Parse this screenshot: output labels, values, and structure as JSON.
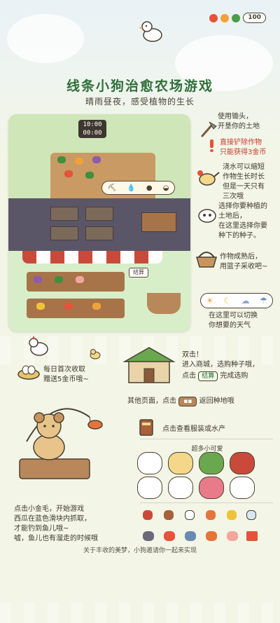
{
  "status": {
    "coins": "100",
    "colors": [
      "#e5533a",
      "#f0a23a",
      "#4a9c4c"
    ]
  },
  "header": {
    "title": "线条小狗治愈农场游戏",
    "subtitle": "晴雨昼夜，感受植物的生长"
  },
  "game_preview": {
    "clock_top": "10:00",
    "clock_bottom": "00:00",
    "checkout_label": "结算"
  },
  "instructions": {
    "hoe": "使用锄头，\n开垦你的土地",
    "shovel": "直接铲除作物\n只能获得3金币",
    "water": "浇水可以缩短\n作物生长时长\n但是一天只有\n三次哦",
    "seed": "选择你要种植的\n土地后，\n在这里选择你要\n种下的种子。",
    "harvest": "作物成熟后，\n用篮子采收吧~",
    "weather": "在这里可以切换\n你想要的天气",
    "daily_reward": "每日首次收取\n赠送5金币哦~",
    "shop_prefix": "双击！\n进入商城，选购种子哦，",
    "shop_click": "点击",
    "shop_button": "结算",
    "shop_suffix": "完成选购",
    "return_prefix": "其他页面，点击",
    "return_suffix": "返回种地哦",
    "book": "点击查看服装或水产",
    "fishing": "点击小金毛，开始游戏\n西瓜在蓝色滑块内抓取，\n才能钓到鱼儿哦~\n嘘，鱼儿也有溜走的时候哦"
  },
  "cute_section": {
    "label": "超多小可爱"
  },
  "footer": {
    "text": "关于丰收的美梦，小狗邀请你一起来实现"
  }
}
